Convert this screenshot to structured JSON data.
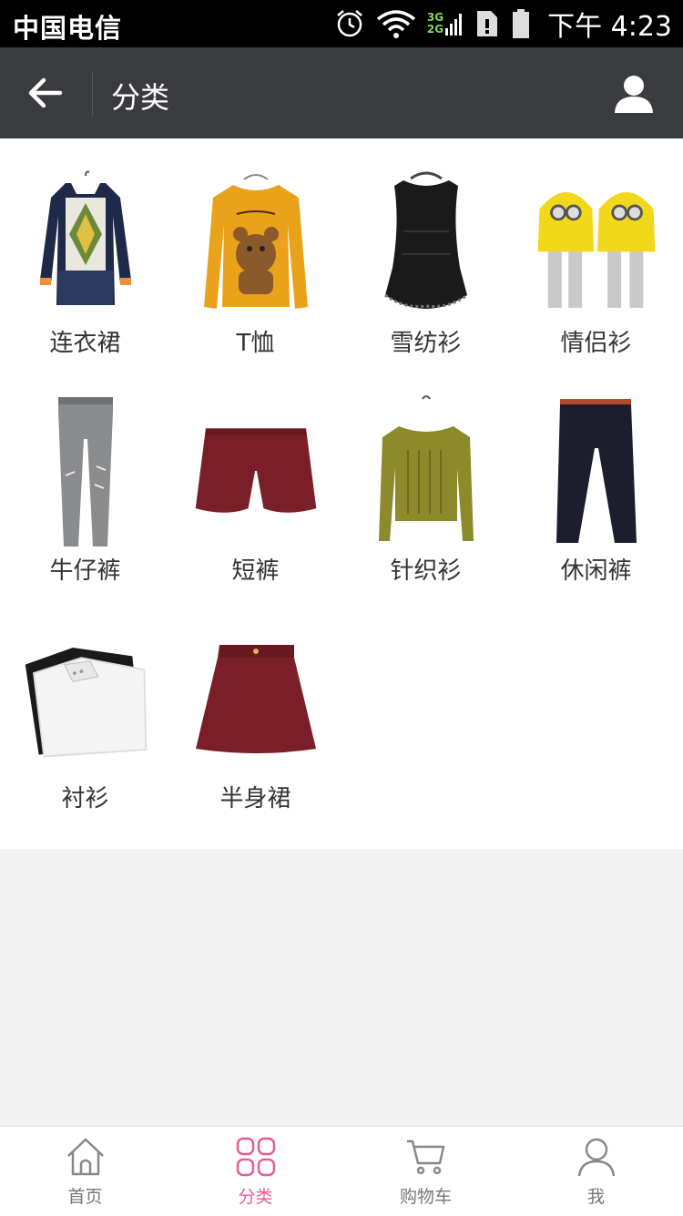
{
  "status_bar": {
    "carrier": "中国电信",
    "network_3g": "3G",
    "network_2g": "2G",
    "time": "下午 4:23"
  },
  "app_bar": {
    "title": "分类",
    "back_icon": "arrow-left-icon",
    "user_icon": "user-icon"
  },
  "categories": [
    {
      "label": "连衣裙",
      "icon": "dress-image"
    },
    {
      "label": "T恤",
      "icon": "tshirt-image"
    },
    {
      "label": "雪纺衫",
      "icon": "chiffon-top-image"
    },
    {
      "label": "情侣衫",
      "icon": "couple-hoodie-image"
    },
    {
      "label": "牛仔裤",
      "icon": "jeans-image"
    },
    {
      "label": "短裤",
      "icon": "shorts-image"
    },
    {
      "label": "针织衫",
      "icon": "knit-sweater-image"
    },
    {
      "label": "休闲裤",
      "icon": "casual-pants-image"
    },
    {
      "label": "衬衫",
      "icon": "shirt-image"
    },
    {
      "label": "半身裙",
      "icon": "skirt-image"
    }
  ],
  "bottom_nav": {
    "items": [
      {
        "label": "首页",
        "icon": "home-icon",
        "active": false
      },
      {
        "label": "分类",
        "icon": "category-grid-icon",
        "active": true
      },
      {
        "label": "购物车",
        "icon": "cart-icon",
        "active": false
      },
      {
        "label": "我",
        "icon": "user-icon",
        "active": false
      }
    ]
  },
  "colors": {
    "app_bar_bg": "#3a3b3f",
    "accent_pink": "#e85d94",
    "background": "#f1f1f1"
  }
}
